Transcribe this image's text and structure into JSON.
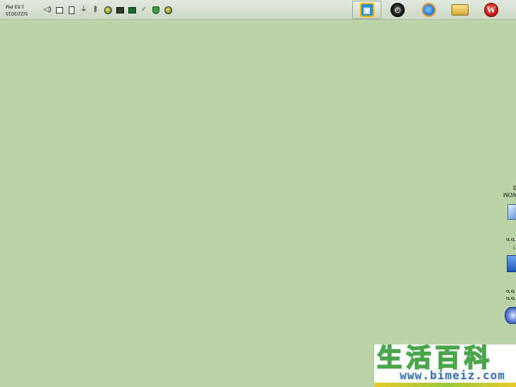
{
  "taskbar": {
    "clock": {
      "time": "1:53 PM",
      "date": "5/22/2015"
    },
    "tray_icons": [
      {
        "name": "volume-icon",
        "glyph": "◁)"
      },
      {
        "name": "network-icon",
        "glyph": ""
      },
      {
        "name": "battery-icon",
        "glyph": ""
      },
      {
        "name": "usb-icon",
        "glyph": "⏚"
      },
      {
        "name": "bluetooth-icon",
        "glyph": "ᛒ"
      },
      {
        "name": "antivirus-icon",
        "glyph": ""
      },
      {
        "name": "display-icon",
        "glyph": ""
      },
      {
        "name": "nvidia-icon",
        "glyph": ""
      },
      {
        "name": "sync-icon",
        "glyph": ""
      },
      {
        "name": "security-shield-icon",
        "glyph": ""
      },
      {
        "name": "update-icon",
        "glyph": ""
      }
    ],
    "pinned_apps": [
      {
        "name": "file-explorer-icon",
        "glyph": ""
      },
      {
        "name": "clock-gadget-icon",
        "glyph": ""
      },
      {
        "name": "browser-icon",
        "glyph": ""
      },
      {
        "name": "folder-icon",
        "glyph": ""
      },
      {
        "name": "wikihow-icon",
        "glyph": "W"
      }
    ]
  },
  "desktop": {
    "background_color": "#bbd3a6",
    "icons": [
      {
        "name": "desktop-icon-monitor",
        "label_line1": "3",
        "label_line2": "WOM"
      },
      {
        "name": "desktop-icon-folder",
        "label_line1": "ᓀᓀ",
        "label_line2": "!"
      },
      {
        "name": "desktop-icon-network",
        "label_line1": "ᓀᓀ",
        "label_line2": "ᓀᓀ"
      }
    ]
  },
  "watermark": {
    "chinese_text": "生活百科",
    "url": "www.bimeiz.com"
  }
}
